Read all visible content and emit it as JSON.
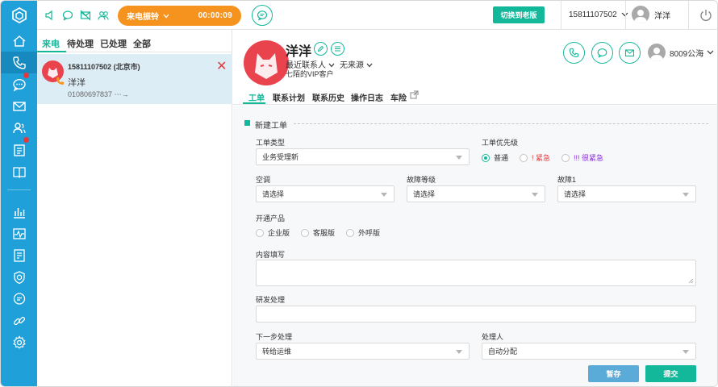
{
  "colors": {
    "rail": "#1fa0d9",
    "accent": "#13b89a",
    "ringing": "#f6921e",
    "danger": "#e4393c",
    "selected_row": "#dcedf6",
    "save_button": "#5aabd8"
  },
  "rail": {
    "items": [
      "app-logo-icon",
      "home-icon",
      "phone-icon",
      "chat-icon",
      "mail-icon",
      "contacts-icon",
      "ticket-icon",
      "book-icon",
      "report-icon",
      "monitor-icon",
      "notes-icon",
      "shield-icon",
      "message-icon",
      "link-icon",
      "settings-icon"
    ]
  },
  "topbar": {
    "call_status": "来电振铃",
    "call_timer": "00:00:09",
    "switch_label": "切换到老版",
    "account": "15811107502",
    "user_name": "洋洋"
  },
  "list": {
    "tabs": [
      "来电",
      "待处理",
      "已处理",
      "全部"
    ],
    "active_tab": "来电",
    "item": {
      "number": "15811107502 (北京市)",
      "name": "洋洋",
      "sub": "01080697837"
    }
  },
  "customer": {
    "name": "洋洋",
    "recent_contact": "最近联系人",
    "source": "无来源",
    "tag": "七陌的VIP客户"
  },
  "agent": {
    "name": "8009公海"
  },
  "tabs": [
    "工单",
    "联系计划",
    "联系历史",
    "操作日志",
    "车险"
  ],
  "form": {
    "section_title": "新建工单",
    "ticket_type_label": "工单类型",
    "ticket_type_value": "业务受理新",
    "priority_label": "工单优先级",
    "priority_options": [
      "普通",
      "! 紧急",
      "!!! 很紧急"
    ],
    "priority_selected": "普通",
    "ac_label": "空调",
    "ac_value": "请选择",
    "fault_level_label": "故障等级",
    "fault_level_value": "请选择",
    "fault1_label": "故障1",
    "fault1_value": "请选择",
    "product_label": "开通产品",
    "product_options": [
      "企业版",
      "客服版",
      "外呼版"
    ],
    "content_label": "内容填写",
    "rd_label": "研发处理",
    "next_label": "下一步处理",
    "next_value": "转给运维",
    "handler_label": "处理人",
    "handler_value": "自动分配",
    "save_label": "暂存",
    "submit_label": "提交"
  }
}
